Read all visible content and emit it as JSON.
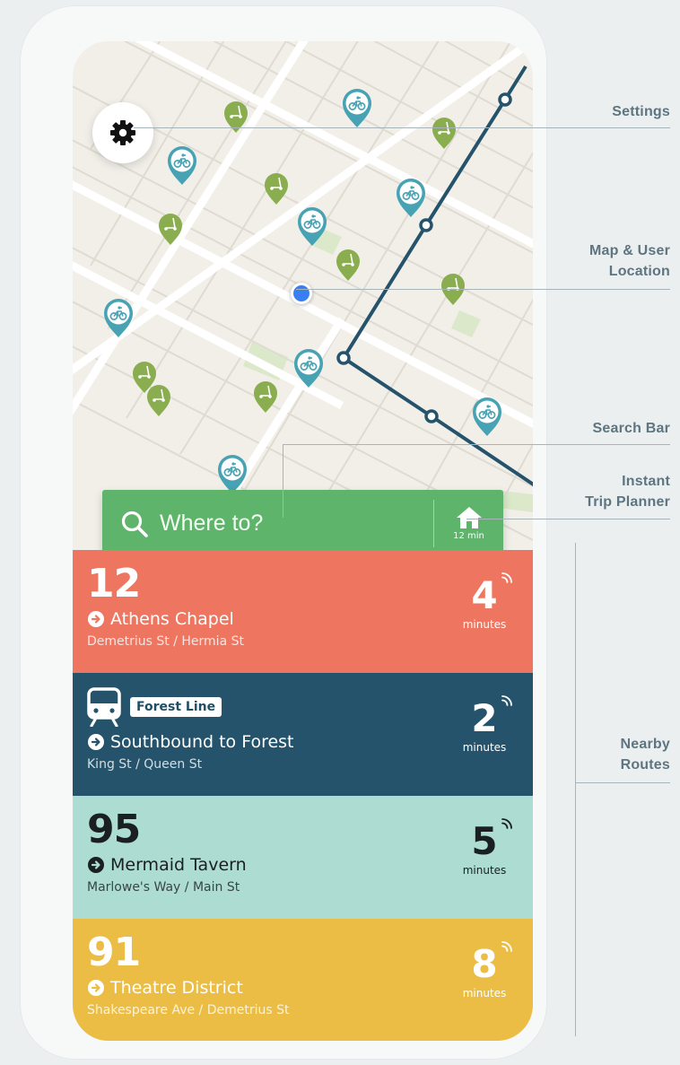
{
  "annotations": {
    "settings": "Settings",
    "map_line1": "Map & User",
    "map_line2": "Location",
    "search": "Search Bar",
    "planner_line1": "Instant",
    "planner_line2": "Trip Planner",
    "nearby_line1": "Nearby",
    "nearby_line2": "Routes"
  },
  "map": {
    "transit_line_color": "#24536b",
    "bike_pin_color": "#47a3b4",
    "scooter_pin_color": "#8aae4f",
    "user_location_color": "#3a7ff2"
  },
  "search": {
    "placeholder": "Where to?",
    "home_eta": "12 min",
    "icon": "search-icon",
    "home_icon": "home-icon",
    "color": "#5eb46b"
  },
  "routes": [
    {
      "number": "12",
      "destination": "Athens Chapel",
      "stop": "Demetrius St / Hermia St",
      "eta": "4",
      "eta_unit": "minutes",
      "color": "#ee7660",
      "text_color": "#ffffff"
    },
    {
      "line_badge": "Forest Line",
      "destination": "Southbound to Forest",
      "stop": "King St / Queen St",
      "eta": "2",
      "eta_unit": "minutes",
      "color": "#24536b",
      "text_color": "#ffffff",
      "icon": "train-icon"
    },
    {
      "number": "95",
      "destination": "Mermaid Tavern",
      "stop": "Marlowe's Way / Main St",
      "eta": "5",
      "eta_unit": "minutes",
      "color": "#acdcd2",
      "text_color": "#1a1f22"
    },
    {
      "number": "91",
      "destination": "Theatre District",
      "stop": "Shakespeare Ave / Demetrius St",
      "eta": "8",
      "eta_unit": "minutes",
      "color": "#ecbd45",
      "text_color": "#ffffff"
    }
  ]
}
